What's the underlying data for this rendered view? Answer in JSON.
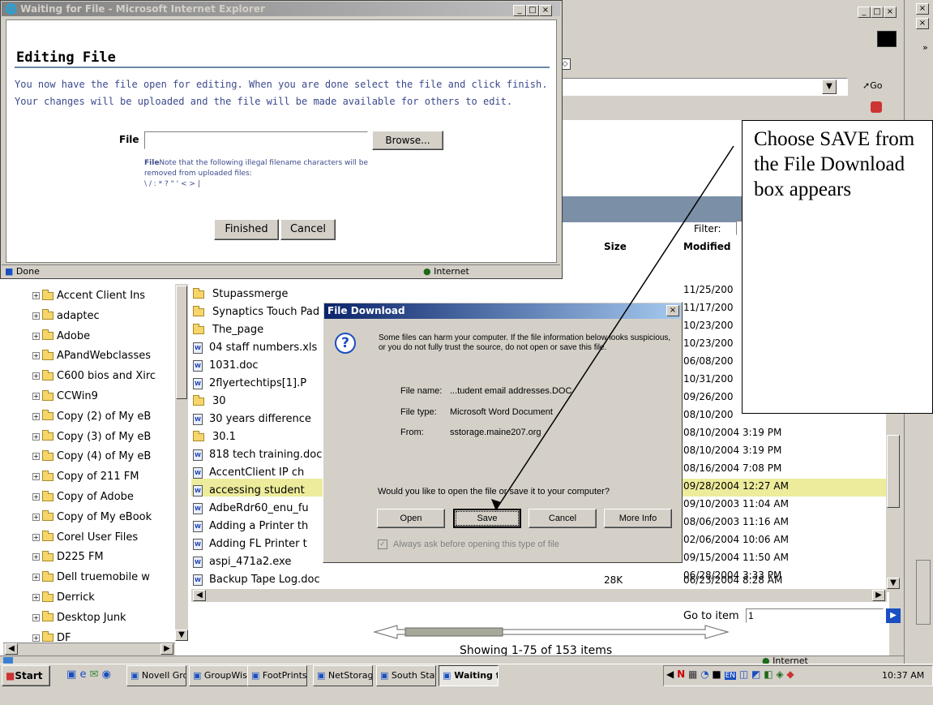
{
  "main_window": {
    "status": "Internet",
    "go_label": "Go"
  },
  "tree_items": [
    "Accent Client Ins",
    "adaptec",
    "Adobe",
    "APandWebclasses",
    "C600 bios and Xirc",
    "CCWin9",
    "Copy (2) of My eB",
    "Copy (3) of My eB",
    "Copy (4) of My eB",
    "Copy of 211 FM",
    "Copy of Adobe",
    "Copy of My eBook",
    "Corel User Files",
    "D225 FM",
    "Dell truemobile w",
    "Derrick",
    "Desktop Junk",
    "DF"
  ],
  "file_list": {
    "headers": {
      "size": "Size",
      "modified": "Modified"
    },
    "filter_label": "Filter:",
    "rows": [
      {
        "name": "Stupassmerge",
        "size": "",
        "modified": "11/25/200"
      },
      {
        "name": "Synaptics Touch Pad Drivers",
        "size": "",
        "modified": "11/17/200"
      },
      {
        "name": "The_page",
        "size": "",
        "modified": "10/23/200"
      },
      {
        "name": "04 staff numbers.xls",
        "size": "",
        "modified": "10/23/200"
      },
      {
        "name": "1031.doc",
        "size": "",
        "modified": "06/08/200"
      },
      {
        "name": "2flyertechtips[1].P",
        "size": "",
        "modified": "10/31/200"
      },
      {
        "name": "30",
        "size": "",
        "modified": "09/26/200"
      },
      {
        "name": "30 years difference",
        "size": "",
        "modified": "08/10/200"
      },
      {
        "name": "30.1",
        "size": "",
        "modified": "08/10/2004 3:19 PM"
      },
      {
        "name": "818 tech training.doc",
        "size": "",
        "modified": "08/10/2004 3:19 PM"
      },
      {
        "name": "AccentClient IP ch",
        "size": "",
        "modified": "08/16/2004 7:08 PM"
      },
      {
        "name": "accessing student",
        "size": "",
        "modified": "09/28/2004 12:27 AM"
      },
      {
        "name": "AdbeRdr60_enu_fu",
        "size": "",
        "modified": "09/10/2003 11:04 AM"
      },
      {
        "name": "Adding a Printer th",
        "size": "",
        "modified": "08/06/2003 11:16 AM"
      },
      {
        "name": "Adding FL Printer t",
        "size": "",
        "modified": "02/06/2004 10:06 AM"
      },
      {
        "name": "aspi_471a2.exe",
        "size": "",
        "modified": "09/15/2004 11:50 AM"
      },
      {
        "name": "Backup Tape Log.doc",
        "size": "28K",
        "modified": "06/28/2004 3:33 PM"
      }
    ],
    "last_modified": "06/23/2004 8:28 AM",
    "goto_label": "Go to item",
    "goto_value": "1",
    "showing": "Showing 1-75 of 153 items"
  },
  "edit_window": {
    "title": "Waiting for File - Microsoft Internet Explorer",
    "heading": "Editing File",
    "description": "You now have the file open for editing. When you are done select the file and click finish. Your changes will be uploaded and the file will be made available for others to edit.",
    "file_label": "File",
    "browse": "Browse...",
    "note_bold": "File",
    "note": "Note that the following illegal filename characters will be removed from uploaded files:",
    "chars": "\\ / : * ? \" ' < > |",
    "finished": "Finished",
    "cancel": "Cancel",
    "status": "Done",
    "zone": "Internet"
  },
  "download": {
    "title": "File Download",
    "warning": "Some files can harm your computer. If the file information below looks suspicious, or you do not fully trust the source, do not open or save this file.",
    "name_label": "File name:",
    "name_value": "...tudent email addresses.DOC",
    "type_label": "File type:",
    "type_value": "Microsoft Word Document",
    "from_label": "From:",
    "from_value": "sstorage.maine207.org",
    "question": "Would you like to open the file or save it to your computer?",
    "open": "Open",
    "save": "Save",
    "cancel": "Cancel",
    "more": "More Info",
    "always": "Always ask before opening this type of file"
  },
  "callout": {
    "text": "Choose SAVE from the File Download box appears"
  },
  "taskbar": {
    "start": "Start",
    "tasks": [
      "Novell Gro...",
      "GroupWise...",
      "FootPrints ...",
      "NetStorag...",
      "South Staf...",
      "Waiting f..."
    ],
    "clock": "10:37 AM",
    "tray": [
      "N",
      "EN"
    ]
  }
}
